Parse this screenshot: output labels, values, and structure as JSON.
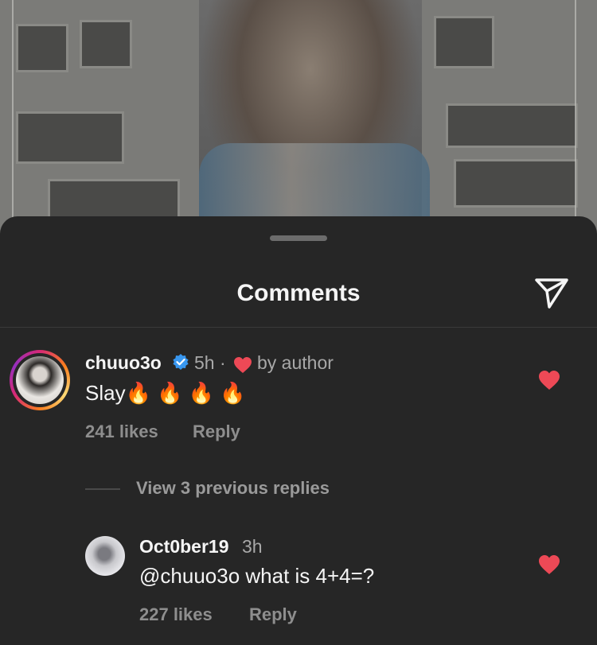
{
  "sheet": {
    "title": "Comments"
  },
  "comment": {
    "username": "chuuo3o",
    "time": "5h",
    "separator": "·",
    "author_like_label": "by author",
    "text": "Slay🔥 🔥 🔥 🔥",
    "likes": "241 likes",
    "reply_label": "Reply",
    "view_replies_label": "View 3 previous replies"
  },
  "reply": {
    "username": "Oct0ber19",
    "time": "3h",
    "text": "@chuuo3o what is 4+4=?",
    "likes": "227 likes",
    "reply_label": "Reply"
  },
  "colors": {
    "sheet_bg": "#262626",
    "heart": "#ed4956",
    "verified": "#3897f0",
    "secondary_text": "#a8a8a8"
  },
  "icons": [
    "send-icon",
    "verified-badge-icon",
    "heart-icon",
    "like-heart-icon"
  ]
}
